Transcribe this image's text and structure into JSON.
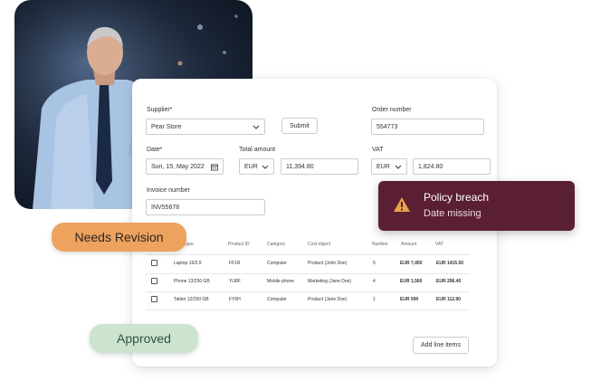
{
  "form": {
    "supplier_label": "Supplier*",
    "supplier_value": "Pear Store",
    "submit_label": "Submit",
    "order_number_label": "Order number",
    "order_number_value": "554773",
    "date_label": "Date*",
    "date_value": "Sun, 15, May 2022",
    "total_amount_label": "Total amount",
    "total_currency": "EUR",
    "total_value": "11,394.80",
    "vat_label": "VAT",
    "vat_currency": "EUR",
    "vat_value": "1,824.80",
    "invoice_number_label": "Invoice number",
    "invoice_number_value": "INV55678"
  },
  "table": {
    "columns": [
      "ct type",
      "Product ID",
      "Category",
      "Cost object",
      "Number",
      "Amount",
      "VAT"
    ],
    "rows": [
      {
        "product": "Laptop 16/2.9",
        "id": "FF1R",
        "category": "Computer",
        "cost_object": "Product (John Doe)",
        "number": "5",
        "amount": "EUR 7,450",
        "vat": "EUR 1415.50"
      },
      {
        "product": "Phone 13/250 GB",
        "id": "YU8F",
        "category": "Mobile phone",
        "cost_object": "Marketing (Jane Doe)",
        "number": "4",
        "amount": "EUR 1,560",
        "vat": "EUR 296.40"
      },
      {
        "product": "Tablet 12/250 GB",
        "id": "FY6H",
        "category": "Computer",
        "cost_object": "Product (Jane Doe)",
        "number": "1",
        "amount": "EUR 590",
        "vat": "EUR 112.90"
      }
    ],
    "add_line_items_label": "Add line items"
  },
  "badges": {
    "needs_revision": "Needs Revision",
    "approved": "Approved"
  },
  "alert": {
    "title": "Policy breach",
    "message": "Date missing",
    "icon": "warning-icon"
  },
  "colors": {
    "needs_revision_bg": "#eda25e",
    "approved_bg": "#cbe3cf",
    "alert_bg": "#5b1f33",
    "warning_icon": "#e8a24a"
  }
}
